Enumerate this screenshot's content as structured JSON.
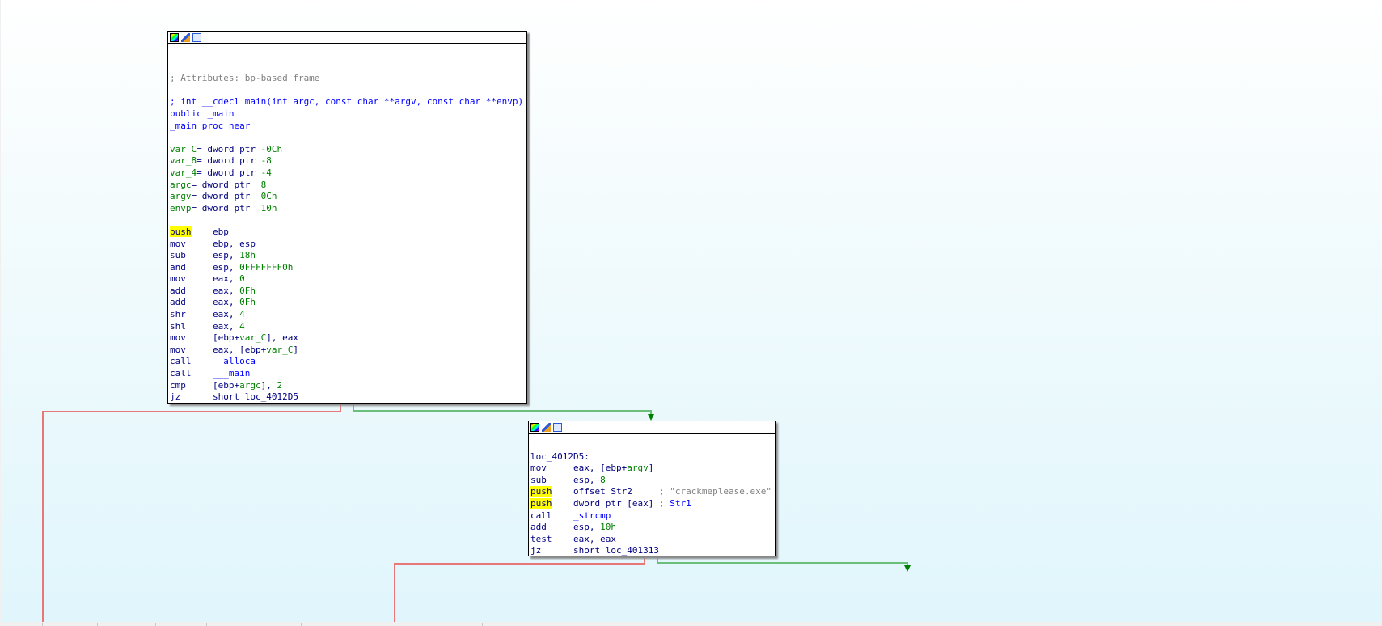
{
  "colors": {
    "background_top": "#ffffff",
    "background_bottom": "#e0f6fc",
    "false_edge": "#e87878",
    "true_edge": "#6cbf7a",
    "highlight": "#ffff00"
  },
  "nodes": [
    {
      "id": "main",
      "header_icons": [
        "color-icon",
        "edit-icon",
        "graph-icon"
      ],
      "lines": [
        [],
        [],
        [
          [
            "; Attributes: bp-based frame",
            "c"
          ]
        ],
        [],
        [
          [
            "; int __cdecl main(int argc, const char **argv, const char **envp)",
            "b"
          ]
        ],
        [
          [
            "public _main",
            "b"
          ]
        ],
        [
          [
            "_main proc near",
            "b"
          ]
        ],
        [],
        [
          [
            "var_C",
            "v"
          ],
          [
            "= dword ptr ",
            "o"
          ],
          [
            "-0Ch",
            "n"
          ]
        ],
        [
          [
            "var_8",
            "v"
          ],
          [
            "= dword ptr ",
            "o"
          ],
          [
            "-8",
            "n"
          ]
        ],
        [
          [
            "var_4",
            "v"
          ],
          [
            "= dword ptr ",
            "o"
          ],
          [
            "-4",
            "n"
          ]
        ],
        [
          [
            "argc",
            "v"
          ],
          [
            "= dword ptr  ",
            "o"
          ],
          [
            "8",
            "n"
          ]
        ],
        [
          [
            "argv",
            "v"
          ],
          [
            "= dword ptr  ",
            "o"
          ],
          [
            "0Ch",
            "n"
          ]
        ],
        [
          [
            "envp",
            "v"
          ],
          [
            "= dword ptr  ",
            "o"
          ],
          [
            "10h",
            "n"
          ]
        ],
        [],
        [
          [
            "push",
            "h"
          ],
          [
            "    ebp",
            "o"
          ]
        ],
        [
          [
            "mov",
            "m"
          ],
          [
            "     ebp, esp",
            "o"
          ]
        ],
        [
          [
            "sub",
            "m"
          ],
          [
            "     esp, ",
            "o"
          ],
          [
            "18h",
            "n"
          ]
        ],
        [
          [
            "and",
            "m"
          ],
          [
            "     esp, ",
            "o"
          ],
          [
            "0FFFFFFF0h",
            "n"
          ]
        ],
        [
          [
            "mov",
            "m"
          ],
          [
            "     eax, ",
            "o"
          ],
          [
            "0",
            "n"
          ]
        ],
        [
          [
            "add",
            "m"
          ],
          [
            "     eax, ",
            "o"
          ],
          [
            "0Fh",
            "n"
          ]
        ],
        [
          [
            "add",
            "m"
          ],
          [
            "     eax, ",
            "o"
          ],
          [
            "0Fh",
            "n"
          ]
        ],
        [
          [
            "shr",
            "m"
          ],
          [
            "     eax, ",
            "o"
          ],
          [
            "4",
            "n"
          ]
        ],
        [
          [
            "shl",
            "m"
          ],
          [
            "     eax, ",
            "o"
          ],
          [
            "4",
            "n"
          ]
        ],
        [
          [
            "mov",
            "m"
          ],
          [
            "     [ebp+",
            "o"
          ],
          [
            "var_C",
            "v"
          ],
          [
            "], eax",
            "o"
          ]
        ],
        [
          [
            "mov",
            "m"
          ],
          [
            "     eax, [ebp+",
            "o"
          ],
          [
            "var_C",
            "v"
          ],
          [
            "]",
            "o"
          ]
        ],
        [
          [
            "call",
            "m"
          ],
          [
            "    __alloca",
            "b"
          ]
        ],
        [
          [
            "call",
            "m"
          ],
          [
            "    ___main",
            "b"
          ]
        ],
        [
          [
            "cmp",
            "m"
          ],
          [
            "     [ebp+",
            "o"
          ],
          [
            "argc",
            "v"
          ],
          [
            "], ",
            "o"
          ],
          [
            "2",
            "n"
          ]
        ],
        [
          [
            "jz",
            "m"
          ],
          [
            "      short loc_4012D5",
            "o"
          ]
        ]
      ]
    },
    {
      "id": "loc_4012D5",
      "header_icons": [
        "color-icon",
        "edit-icon",
        "graph-icon"
      ],
      "lines": [
        [],
        [
          [
            "loc_4012D5:",
            "o"
          ]
        ],
        [
          [
            "mov",
            "m"
          ],
          [
            "     eax, [ebp+",
            "o"
          ],
          [
            "argv",
            "v"
          ],
          [
            "]",
            "o"
          ]
        ],
        [
          [
            "sub",
            "m"
          ],
          [
            "     esp, ",
            "o"
          ],
          [
            "8",
            "n"
          ]
        ],
        [
          [
            "push",
            "h"
          ],
          [
            "    offset Str2     ",
            "o"
          ],
          [
            "; \"crackmeplease.exe\"",
            "c"
          ]
        ],
        [
          [
            "push",
            "h"
          ],
          [
            "    dword ptr [eax] ",
            "o"
          ],
          [
            "; ",
            "c"
          ],
          [
            "Str1",
            "b"
          ]
        ],
        [
          [
            "call",
            "m"
          ],
          [
            "    _strcmp",
            "b"
          ]
        ],
        [
          [
            "add",
            "m"
          ],
          [
            "     esp, ",
            "o"
          ],
          [
            "10h",
            "n"
          ]
        ],
        [
          [
            "test",
            "m"
          ],
          [
            "    eax, eax",
            "o"
          ]
        ],
        [
          [
            "jz",
            "m"
          ],
          [
            "      short loc_401313",
            "o"
          ]
        ]
      ]
    }
  ]
}
